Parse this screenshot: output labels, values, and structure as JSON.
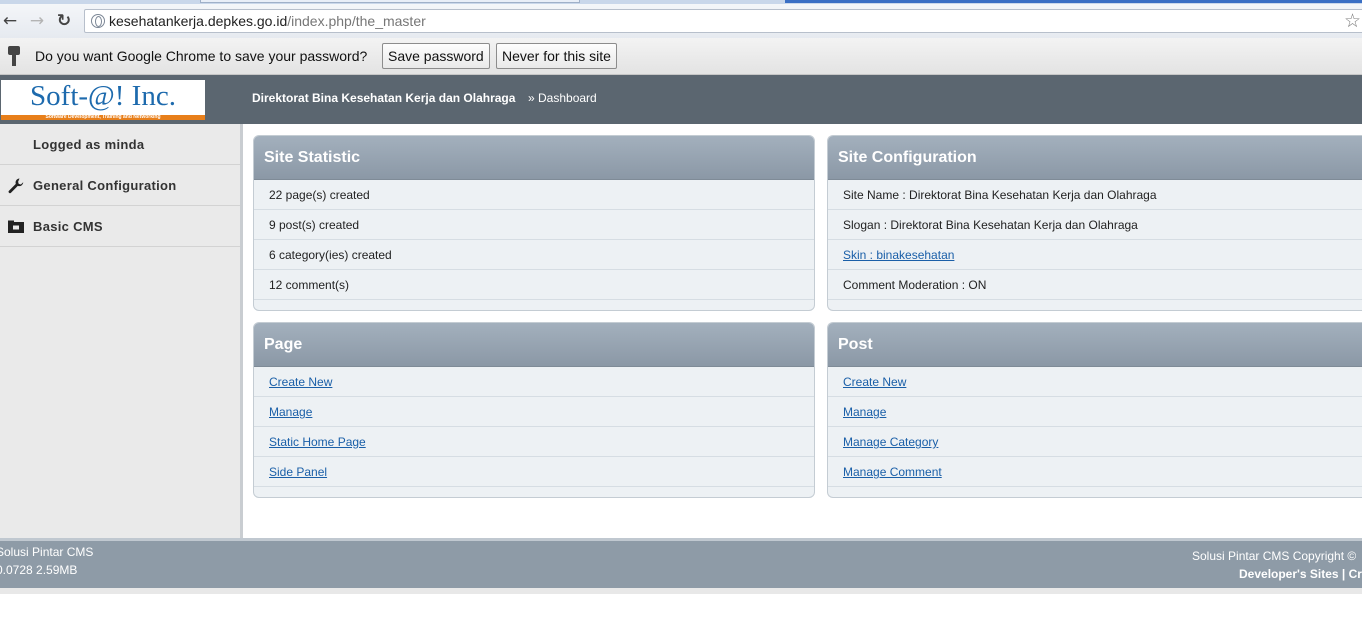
{
  "browser": {
    "url_host": "kesehatankerja.depkes.go.id",
    "url_path": "/index.php/the_master",
    "back_icon": "←",
    "forward_icon": "→",
    "reload_icon": "↻",
    "star_icon": "☆"
  },
  "infobar": {
    "message": "Do you want Google Chrome to save your password?",
    "save_label": "Save password",
    "never_label": "Never for this site"
  },
  "header": {
    "logo_text": "Soft-@! Inc.",
    "logo_tagline": "Software Development, Training and Networking",
    "site_title": "Direktorat Bina Kesehatan Kerja dan Olahraga",
    "breadcrumb": "» Dashboard",
    "colors": {
      "bar": "#5b6670",
      "logo_accent": "#e87f1a",
      "logo_text": "#1d6aad"
    }
  },
  "sidebar": {
    "items": [
      {
        "label": "Logged as minda",
        "icon": ""
      },
      {
        "label": "General Configuration",
        "icon": "wrench-icon"
      },
      {
        "label": "Basic CMS",
        "icon": "folder-icon"
      }
    ]
  },
  "panels": {
    "site_statistic": {
      "title": "Site Statistic",
      "rows": [
        "22 page(s) created",
        "9 post(s) created",
        "6 category(ies) created",
        "12 comment(s)"
      ]
    },
    "site_configuration": {
      "title": "Site Configuration",
      "rows": [
        "Site Name : Direktorat Bina Kesehatan Kerja dan Olahraga",
        "Slogan : Direktorat Bina Kesehatan Kerja dan Olahraga",
        "Skin : binakesehatan",
        "Comment Moderation : ON"
      ]
    },
    "page": {
      "title": "Page",
      "links": [
        "Create New",
        "Manage",
        "Static Home Page",
        "Side Panel"
      ]
    },
    "post": {
      "title": "Post",
      "links": [
        "Create New",
        "Manage",
        "Manage Category",
        "Manage Comment"
      ]
    }
  },
  "footer": {
    "left_line1": "Solusi Pintar CMS",
    "left_line2": "0.0728 2.59MB",
    "right_line1": "Solusi Pintar CMS Copyright ©",
    "right_line2": "Developer's Sites | Cr"
  }
}
